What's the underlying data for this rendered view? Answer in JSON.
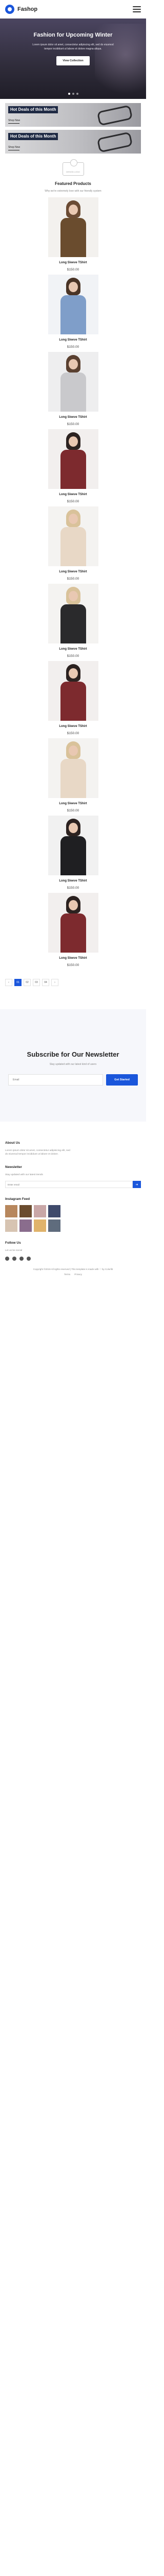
{
  "header": {
    "brand": "Fashop"
  },
  "hero": {
    "title": "Fashion for Upcoming Winter",
    "text": "Lorem ipsum dolor sit amet, consectetur adipiscing elit, sed do eiusmod tempor incididunt ut labore et dolore magna aliqua.",
    "button": "View Collection"
  },
  "promos": [
    {
      "label": "Hot Deals of this Month",
      "link": "Shop Now"
    },
    {
      "label": "Hot Deals of this Month",
      "link": "Shop Now"
    }
  ],
  "badge": {
    "text": "DESIGN LOGO"
  },
  "featured": {
    "title": "Featured Products",
    "subtitle": "Why we're extremely love with our friendly system"
  },
  "products": [
    {
      "name": "Long Sleeve TShirt",
      "price": "$150.00",
      "hair": "#6b4b34",
      "top": "#6a4c2e",
      "bg": "#f3f1ee"
    },
    {
      "name": "Long Sleeve TShirt",
      "price": "$150.00",
      "hair": "#4a3426",
      "top": "#7f9ec9",
      "bg": "#f1f3f6"
    },
    {
      "name": "Long Sleeve TShirt",
      "price": "$150.00",
      "hair": "#5a4030",
      "top": "#c9c9cc",
      "bg": "#eeeeef"
    },
    {
      "name": "Long Sleeve TShirt",
      "price": "$150.00",
      "hair": "#2c2220",
      "top": "#7d2a2e",
      "bg": "#f2efee"
    },
    {
      "name": "Long Sleeve TShirt",
      "price": "$150.00",
      "hair": "#d9c29a",
      "top": "#e8d8c6",
      "bg": "#f4f3f1"
    },
    {
      "name": "Long Sleeve TShirt",
      "price": "$150.00",
      "hair": "#d9c29a",
      "top": "#2a2a2c",
      "bg": "#f4f3f1"
    },
    {
      "name": "Long Sleeve TShirt",
      "price": "$150.00",
      "hair": "#2c2220",
      "top": "#7d2a2e",
      "bg": "#f2efee"
    },
    {
      "name": "Long Sleeve TShirt",
      "price": "$150.00",
      "hair": "#d9c29a",
      "top": "#e8d8c6",
      "bg": "#f4f3f1"
    },
    {
      "name": "Long Sleeve TShirt",
      "price": "$150.00",
      "hair": "#2c2220",
      "top": "#1f1f22",
      "bg": "#f1f1f1"
    },
    {
      "name": "Long Sleeve TShirt",
      "price": "$150.00",
      "hair": "#2c2220",
      "top": "#7d2a2e",
      "bg": "#f2efee"
    }
  ],
  "pagination": {
    "prev": "‹",
    "pages": [
      "01",
      "02",
      "03",
      "04"
    ],
    "next": "›"
  },
  "newsletter": {
    "title": "Subscribe for Our Newsletter",
    "text": "Stay updated with our latest kind of users",
    "placeholder": "Email",
    "button": "Get Started"
  },
  "footer": {
    "about_title": "About Us",
    "about_text": "Lorem ipsum dolor sit amet, consectetur adipisicing elit, sed do eiusmod tempor incididunt ut labore et dolore.",
    "news_title": "Newsletter",
    "news_text": "Stay updated with our latest trends",
    "news_placeholder": "Enter email",
    "insta_title": "Instagram Feed",
    "insta_colors": [
      "#b7875d",
      "#6a4c2e",
      "#c9a7a7",
      "#3f4a6b",
      "#d7c4b2",
      "#8a6d8d",
      "#e0b36b",
      "#5f6c7d"
    ],
    "follow_title": "Follow Us",
    "follow_text": "Let us be social",
    "copyright": "Copyright ©2019 All rights reserved | This template is made with ♡ by Colorlib",
    "legal": [
      "Terms",
      "Privacy"
    ]
  }
}
